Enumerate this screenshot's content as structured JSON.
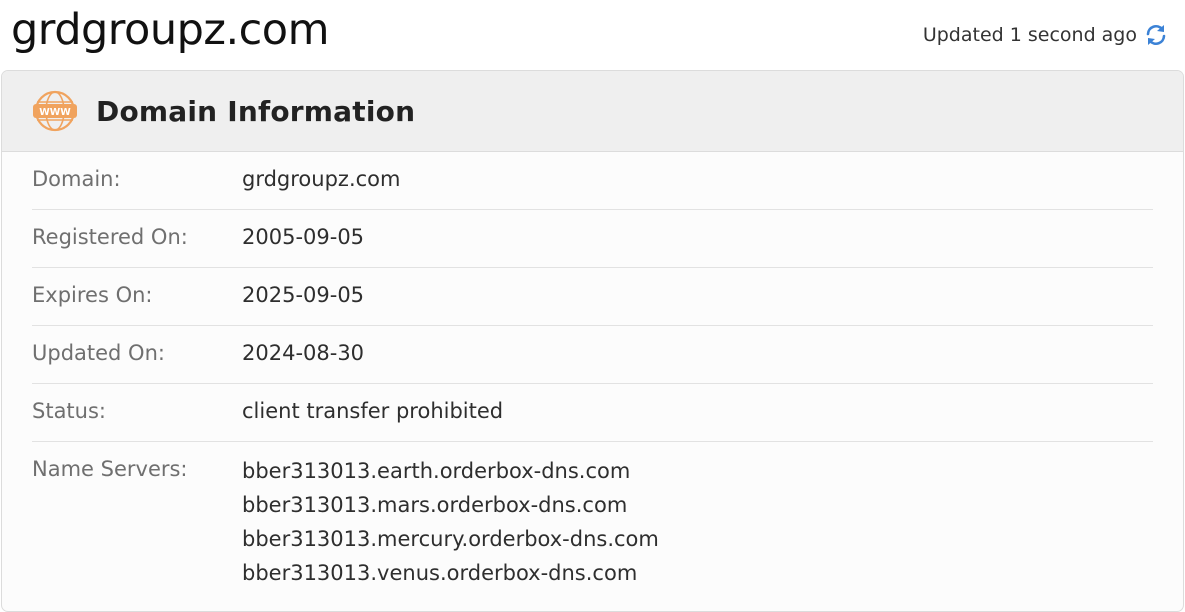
{
  "header": {
    "domain": "grdgroupz.com",
    "updated_text": "Updated 1 second ago",
    "refresh_icon": "refresh-icon",
    "accent_color": "#3b82d6"
  },
  "card": {
    "icon": "www-icon",
    "icon_color": "#f0a35e",
    "title": "Domain Information",
    "rows": [
      {
        "label": "Domain:",
        "value": "grdgroupz.com"
      },
      {
        "label": "Registered On:",
        "value": "2005-09-05"
      },
      {
        "label": "Expires On:",
        "value": "2025-09-05"
      },
      {
        "label": "Updated On:",
        "value": "2024-08-30"
      },
      {
        "label": "Status:",
        "value": "client transfer prohibited"
      }
    ],
    "name_servers": {
      "label": "Name Servers:",
      "values": [
        "bber313013.earth.orderbox-dns.com",
        "bber313013.mars.orderbox-dns.com",
        "bber313013.mercury.orderbox-dns.com",
        "bber313013.venus.orderbox-dns.com"
      ]
    }
  }
}
